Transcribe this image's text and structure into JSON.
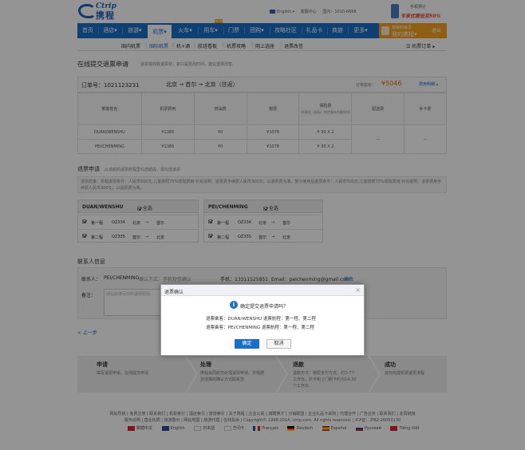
{
  "header": {
    "logo_en": "Ctrip",
    "logo_cn": "携程",
    "lang": "English",
    "help": "客服中心",
    "hotline": "国内：1010-6666",
    "promo_line1": "手机预订",
    "promo_line2": "专享优惠低至50%"
  },
  "nav": {
    "items": [
      "首页",
      "酒店",
      "旅游",
      "机票",
      "火车",
      "用车",
      "门票",
      "团购",
      "攻略社区",
      "礼品卡",
      "商旅",
      "更多"
    ],
    "new_badge": "NEW",
    "user_greeting": "尊敬的会员",
    "user_name": "我的携程",
    "logout": "退出"
  },
  "subnav": {
    "items": [
      "国内机票",
      "国际机票",
      "机+酒",
      "航班看板",
      "机票攻略",
      "网上选座",
      "退票改签"
    ],
    "order_link": "机票订单"
  },
  "page": {
    "title": "在线提交退票申请",
    "subtitle": "退票需收取退票费，如只是更改时间，建议选择改签。"
  },
  "order": {
    "number": "订单号：1021123231",
    "route": "北京 → 首尔 → 北京（往返）",
    "amount_label": "订单总价：",
    "amount": "¥5046",
    "detail_link": "费用明细"
  },
  "fee_table": {
    "headers": [
      "乘客姓名",
      "机票费用",
      "燃油费",
      "税费",
      "保险费",
      "配送费",
      "补卡费"
    ],
    "insurance_sub": "(航意险（国际）航空意外伤害保险)",
    "rows": [
      {
        "name": "DUAN/WENSHU",
        "ticket": "¥1385",
        "fuel": "¥0",
        "tax": "¥1078",
        "ins": "¥ 30 X 2"
      },
      {
        "name": "PEI/CHENMING",
        "ticket": "¥1385",
        "fuel": "¥0",
        "tax": "¥1078",
        "ins": "¥ 30 X 2"
      }
    ],
    "delivery": "—",
    "card": "—"
  },
  "refund": {
    "title": "退票申请",
    "hint": "从该航的退票航程里勾选航段，需勾选退票",
    "note": "退票政策：单程退票条件：人民币500元,儿童按照75%收取费用 补充说明：退票费手续费人民币300元；以退票费为准。部分使用后退票条件：人民币500元,儿童按照75%收取费用 补充说明：退票费用手续费人民币300元；以退票费为准。",
    "passengers": [
      {
        "name": "DUAN/WENSHU",
        "all": "全选",
        "segments": [
          {
            "label": "第一程",
            "flight": "OZ334",
            "from": "北京",
            "to": "首尔"
          },
          {
            "label": "第二程",
            "flight": "OZ335",
            "from": "首尔",
            "to": "北京"
          }
        ]
      },
      {
        "name": "PEI/CHENMING",
        "all": "全选",
        "segments": [
          {
            "label": "第一程",
            "flight": "OZ334",
            "from": "北京",
            "to": "首尔"
          },
          {
            "label": "第二程",
            "flight": "OZ335",
            "from": "首尔",
            "to": "北京"
          }
        ]
      }
    ]
  },
  "contact": {
    "title": "联系人信息",
    "person_label": "联系人：",
    "person_value": "PEI/CHENMING",
    "hint": "确认方式：手机短信确认",
    "phone": "手机：13311525851",
    "email": "Email：peichenming@gmail.com",
    "edit": "修改",
    "remark_label": "备注：",
    "remark_placeholder": "请在此填写您的退票原因"
  },
  "back_link": "< 上一步",
  "steps": [
    {
      "title": "申请",
      "desc": "填写退票申请，在线提交申请"
    },
    {
      "title": "处理",
      "desc": "携程会同航司处理退票申请，并根据您选择的确认方式联系您"
    },
    {
      "title": "退款",
      "desc": "退款方式：按原支付方式，约3-7个工作日；外卡和上门刷卡约为14-30个工作日"
    },
    {
      "title": "成功",
      "desc": "成功完成机票退票流程"
    }
  ],
  "footer": {
    "line1": "网站导航 | 免费注册 | 联系我们 | 机票索引 | 酒店索引 | 旅游索引 | 关于携程 | 企业公民 | 诚聘英才 | 分销联盟 | 企业礼品卡采购 | 代理合作 | 广告业务 | 联系我们 | 友情链接",
    "line2": "服务说明 | 营业执照 | 旅游警示 | 网站地图 | 旅游代理 | 在线投诉 | Copyright© 1999-2014, ctrip.com. All rights reserved. | ICP证：沪B2-20050130",
    "languages": [
      "繁體中文",
      "English",
      "日本語",
      "한국어",
      "Français",
      "Deutsch",
      "Español",
      "Pусский",
      "Tiếng Việt"
    ]
  },
  "modal": {
    "title": "退票确认",
    "close": "×",
    "question": "确定提交退票申请吗？",
    "line1": "退票乘客：DUAN/WENSHU  退票航程：第一程、第二程",
    "line2": "退票乘客：PEI/CHENMING  退票航程：第一程、第二程",
    "confirm": "确定",
    "cancel": "取消"
  },
  "colors": {
    "brand": "#1a6ec9",
    "accent": "#f8a320",
    "price": "#ee6600"
  }
}
